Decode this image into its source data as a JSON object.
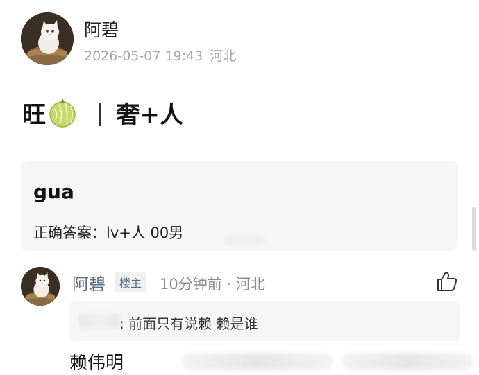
{
  "post": {
    "author": "阿碧",
    "timestamp": "2026-05-07 19:43",
    "location": "河北",
    "text_part1": "旺",
    "separator": "|",
    "text_part2": "奢+人",
    "icons": {
      "melon": "melon-icon"
    }
  },
  "card": {
    "title": "gua",
    "answer": "正确答案：lv+人 00男"
  },
  "comment": {
    "author": "阿碧",
    "badge": "楼主",
    "meta": "10分钟前 · 河北",
    "quote_text": ": 前面只有说赖 赖是谁",
    "text": "赖伟明",
    "icons": {
      "like": "thumbs-up-icon"
    }
  },
  "colors": {
    "meta_gray": "#a6a6a6",
    "comment_name": "#5a6b82",
    "card_bg": "#f6f6f7"
  }
}
